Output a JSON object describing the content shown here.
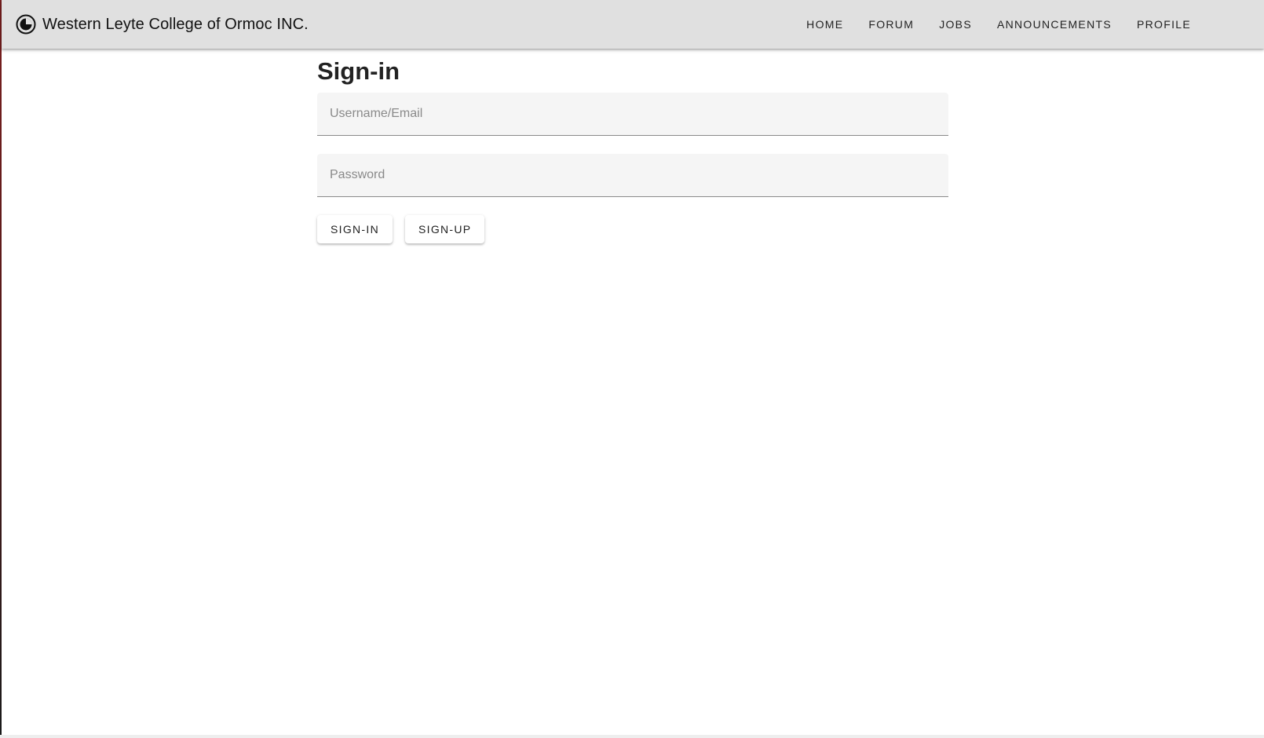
{
  "app": {
    "title": "Western Leyte College of Ormoc INC.",
    "logo_icon": "circle-half-icon"
  },
  "nav": {
    "items": [
      {
        "label": "HOME"
      },
      {
        "label": "FORUM"
      },
      {
        "label": "JOBS"
      },
      {
        "label": "ANNOUNCEMENTS"
      },
      {
        "label": "PROFILE"
      }
    ]
  },
  "signin": {
    "title": "Sign-in",
    "username": {
      "value": "",
      "placeholder": "Username/Email"
    },
    "password": {
      "value": "",
      "placeholder": "Password"
    },
    "signin_label": "SIGN-IN",
    "signup_label": "SIGN-UP"
  },
  "colors": {
    "appbar_bg": "#e0e0e0",
    "field_bg": "#f5f5f5",
    "text": "#222222"
  }
}
